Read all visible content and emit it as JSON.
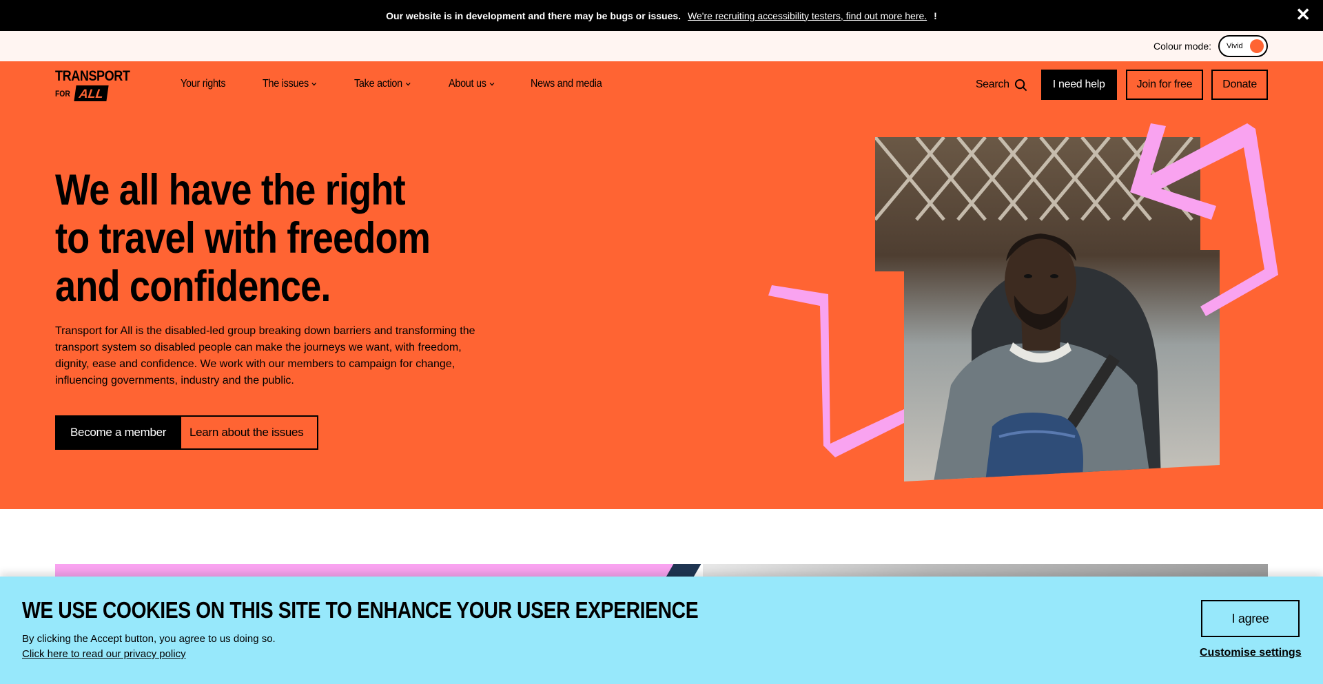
{
  "dev_banner": {
    "message": "Our website is in development and there may be bugs or issues.",
    "link": "We're recruiting accessibility testers, find out more here.",
    "exclamation": "!",
    "close_icon": "close-icon"
  },
  "colour_mode": {
    "label": "Colour mode:",
    "value": "Vivid",
    "knob_color": "#ff6433"
  },
  "header": {
    "logo": {
      "line1": "TRANSPORT",
      "line2_prefix": "FOR",
      "line2_badge": "ALL"
    },
    "nav": [
      {
        "label": "Your rights",
        "has_dropdown": false
      },
      {
        "label": "The issues",
        "has_dropdown": true
      },
      {
        "label": "Take action",
        "has_dropdown": true
      },
      {
        "label": "About us",
        "has_dropdown": true
      },
      {
        "label": "News and media",
        "has_dropdown": false
      }
    ],
    "search_label": "Search",
    "help_label": "I need help",
    "join_label": "Join for free",
    "donate_label": "Donate"
  },
  "hero": {
    "title": "We all have the right to travel with freedom and confidence.",
    "description": "Transport for All is the disabled-led group breaking down barriers and transforming the transport system so disabled people can make the journeys we want, with freedom, dignity, ease and confidence. We work with our members to campaign for change, influencing governments, industry and the public.",
    "primary_button": "Become a member",
    "secondary_button": "Learn about the issues",
    "background_color": "#ff6433",
    "accent_color": "#f9a3f0"
  },
  "cookie": {
    "title": "WE USE COOKIES ON THIS SITE TO ENHANCE YOUR USER EXPERIENCE",
    "text": "By clicking the Accept button, you agree to us doing so.",
    "privacy_link": "Click here to read our privacy policy",
    "agree_button": "I agree",
    "customise_link": "Customise settings",
    "background_color": "#97e8fb"
  }
}
